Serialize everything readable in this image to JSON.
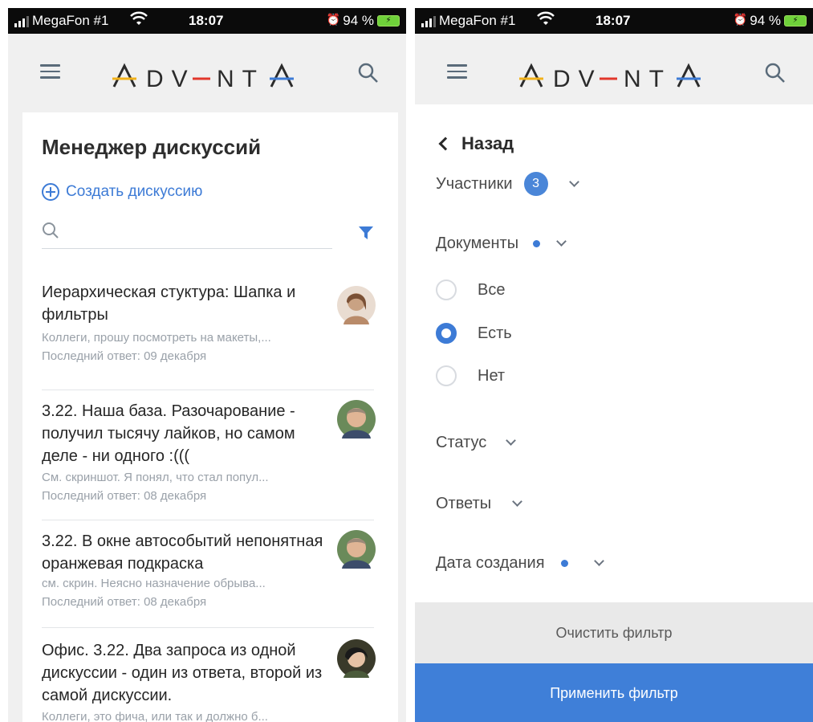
{
  "status_bar": {
    "carrier": "MegaFon #1",
    "time": "18:07",
    "battery": "94 %"
  },
  "logo": {
    "text": "ADVANTA"
  },
  "left": {
    "page_title": "Менеджер дискуссий",
    "create_label": "Создать дискуссию",
    "search_placeholder": "",
    "discussions": [
      {
        "title": "Иерархическая стуктура: Шапка и фильтры",
        "snippet": "Коллеги, прошу посмотреть на макеты,...",
        "last_reply": "Последний ответ: 09 декабря"
      },
      {
        "title": "3.22. Наша база. Разочарование - получил тысячу лайков, но самом деле - ни одного :(((",
        "snippet": "См. скриншот. Я понял, что стал попул...",
        "last_reply": "Последний ответ: 08 декабря"
      },
      {
        "title": "3.22. В окне автособытий непонятная оранжевая подкраска",
        "snippet": "см. скрин. Неясно назначение обрыва...",
        "last_reply": "Последний ответ: 08 декабря"
      },
      {
        "title": "Офис. 3.22. Два запроса из одной дискуссии - один из ответа, второй из самой дискуссии.",
        "snippet": "Коллеги, это фича, или так и должно б...",
        "last_reply": ""
      }
    ]
  },
  "right": {
    "back_label": "Назад",
    "filters": {
      "participants": {
        "label": "Участники",
        "count": "3"
      },
      "documents": {
        "label": "Документы"
      },
      "status": {
        "label": "Статус"
      },
      "answers": {
        "label": "Ответы"
      },
      "created": {
        "label": "Дата создания"
      }
    },
    "document_options": [
      {
        "label": "Все",
        "selected": false
      },
      {
        "label": "Есть",
        "selected": true
      },
      {
        "label": "Нет",
        "selected": false
      }
    ],
    "clear_label": "Очистить фильтр",
    "apply_label": "Применить фильтр"
  },
  "colors": {
    "accent": "#3d7bd6",
    "apply_bg": "#3f7fd8",
    "logo_yellow": "#f2b21a",
    "logo_red": "#e2372b",
    "logo_blue": "#3d7bd6"
  }
}
